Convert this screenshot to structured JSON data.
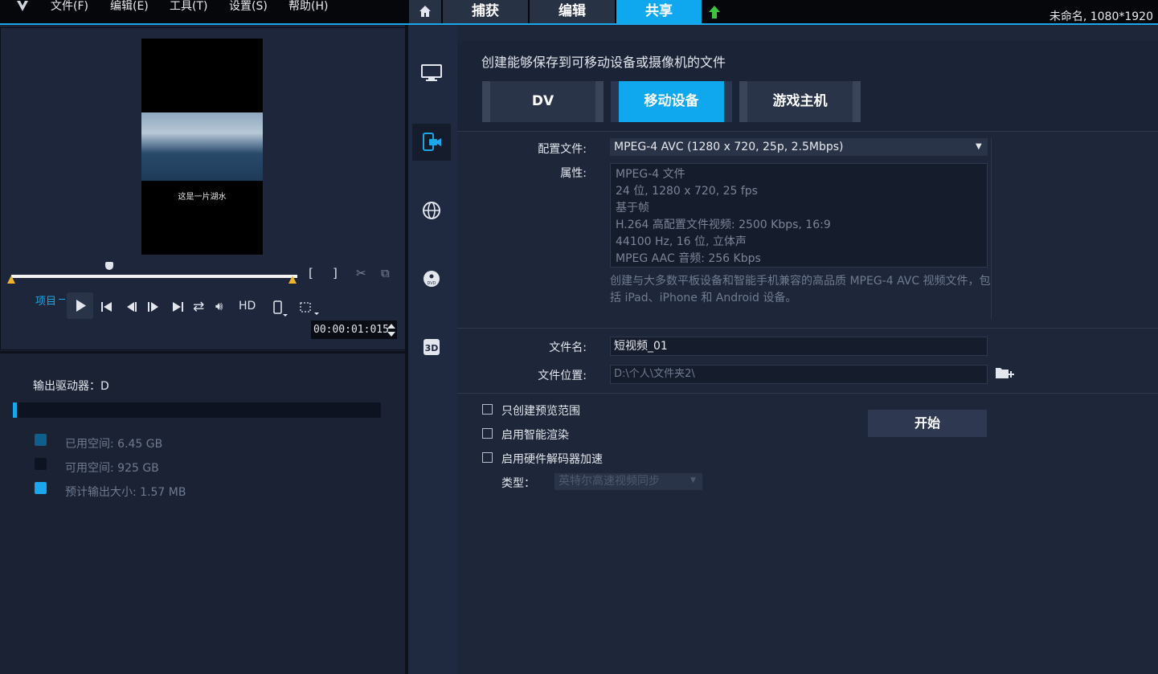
{
  "menu": [
    "文件(F)",
    "编辑(E)",
    "工具(T)",
    "设置(S)",
    "帮助(H)"
  ],
  "tabs": {
    "capture": "捕获",
    "edit": "编辑",
    "share": "共享"
  },
  "project_info": "未命名, 1080*1920",
  "preview": {
    "caption": "这是一片湖水",
    "project_label": "项目",
    "hd_label": "HD",
    "timecode": "00:00:01:015"
  },
  "drive": {
    "label": "输出驱动器：D",
    "used": "已用空间:   6.45 GB",
    "free": "可用空间:   925 GB",
    "estimate": "预计输出大小:   1.57 MB",
    "used_fraction": 0.01
  },
  "main": {
    "heading": "创建能够保存到可移动设备或摄像机的文件",
    "device_tabs": [
      "DV",
      "移动设备",
      "游戏主机"
    ],
    "profile_label": "配置文件:",
    "profile_value": "MPEG-4 AVC (1280 x 720, 25p, 2.5Mbps)",
    "attr_label": "属性:",
    "attributes": [
      "MPEG-4 文件",
      "24 位, 1280 x 720, 25 fps",
      "基于帧",
      "H.264 高配置文件视频: 2500 Kbps, 16:9",
      "44100 Hz, 16 位, 立体声",
      "MPEG AAC 音频: 256 Kbps"
    ],
    "description": "创建与大多数平板设备和智能手机兼容的高品质 MPEG-4 AVC 视频文件，包括 iPad、iPhone 和 Android 设备。",
    "filename_label": "文件名:",
    "filename_value": "短视频_01",
    "fileloc_label": "文件位置:",
    "fileloc_value": "D:\\个人\\文件夹2\\",
    "options": [
      "只创建预览范围",
      "启用智能渲染",
      "启用硬件解码器加速"
    ],
    "type_label": "类型：",
    "type_value": "英特尔高速视频同步",
    "start_label": "开始"
  },
  "colors": {
    "accent": "#0fa8ef",
    "panel": "#1e2739",
    "tab": "#283245"
  }
}
